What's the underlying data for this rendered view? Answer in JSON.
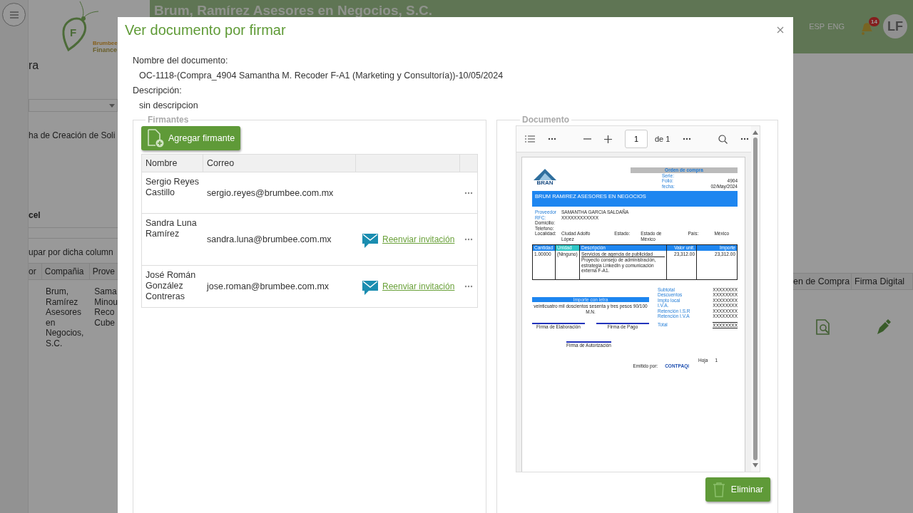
{
  "app_header": {
    "title": "Brum, Ramírez Asesores en Negocios, S.C.",
    "logo": {
      "letter": "F",
      "name_top": "Brumbee",
      "name_bottom": "Finance"
    },
    "languages": [
      "ESP",
      "ENG"
    ],
    "notifications": "14",
    "avatar": "LF"
  },
  "background": {
    "page_title": "ra",
    "filter_label": "ha de Creación de Soli",
    "export_label": "cel",
    "group_hint": "upar por dicha column",
    "left_columns": [
      "or",
      "Compañia",
      "Prove"
    ],
    "company": "Brum, Ramírez Asesores en Negocios, S.C.",
    "provider_lines": [
      "Sama",
      "Minou",
      "Reco",
      "Cube"
    ],
    "right_columns": [
      "en de Compra",
      "Firma Digital"
    ]
  },
  "dialog": {
    "title": "Ver documento por firmar",
    "fields": [
      {
        "label": "Nombre del documento:",
        "value": "OC-1118-(Compra_4904 Samantha M. Recoder F-A1 (Marketing y Consultoría))-10/05/2024"
      },
      {
        "label": "Descripción:",
        "value": "sin descripcion"
      }
    ],
    "signers": {
      "legend": "Firmantes",
      "add_button": "Agregar firmante",
      "columns": [
        "Nombre",
        "Correo"
      ],
      "rows": [
        {
          "name": "Sergio Reyes Castillo",
          "email": "sergio.reyes@brumbee.com.mx"
        },
        {
          "name": "Sandra Luna Ramírez",
          "email": "sandra.luna@brumbee.com.mx",
          "resend_link": "Reenviar invitación"
        },
        {
          "name": "José Román González Contreras",
          "email": "jose.roman@brumbee.com.mx",
          "resend_link": "Reenviar invitación"
        }
      ]
    },
    "document": {
      "legend": "Documento",
      "page_input": "1",
      "page_total": "de 1",
      "page": {
        "logo_text": "BRAN",
        "heading": "Orden de compra",
        "meta": [
          {
            "label": "Serie:"
          },
          {
            "label": "Folio:",
            "value": "4904"
          },
          {
            "label": "fecha:",
            "value": "02/May/2024"
          }
        ],
        "company": "BRUM RAMIREZ ASESORES EN NEGOCIOS",
        "supplier": [
          {
            "label": "Proveedor",
            "value": "SAMANTHA GARCIA SALDAÑA"
          },
          {
            "label": "RFC:",
            "value": "XXXXXXXXXXXX"
          },
          {
            "label": "Domicilio:"
          },
          {
            "label": "Telefono:"
          }
        ],
        "locality": [
          {
            "label": "Localidad:",
            "value": "Ciudad Adolfo López"
          },
          {
            "label": "Estado:",
            "value": "Estado de México"
          },
          {
            "label": "País:",
            "value": "México"
          }
        ],
        "item_columns": [
          "Cantidad",
          "Unidad",
          "Descripción",
          "Valor unit.",
          "Importe"
        ],
        "item": {
          "cells": [
            "1.00000",
            "(Ninguno)",
            "Servicios de agencia de publicidad",
            "23,312.00",
            "23,312.00"
          ],
          "note": "Proyecto consejo de administración, estrategia LinkedIn y comunicación externa F-A1."
        },
        "amount_words_label": "Importe con letra",
        "amount_words": "veinticuatro mil doscientos sesenta y tres pesos 90/100 M.N.",
        "totals": [
          {
            "label": "Subtotal",
            "value": "XXXXXXXX"
          },
          {
            "label": "Descuentos",
            "value": "XXXXXXXX"
          },
          {
            "label": "Impto local",
            "value": "XXXXXXXX"
          },
          {
            "label": "I.V.A.",
            "value": "XXXXXXXX"
          },
          {
            "label": "Retención I.S.R",
            "value": "XXXXXXXX"
          },
          {
            "label": "Retención I.V.A",
            "value": "XXXXXXXX"
          },
          {
            "label": "Total",
            "value": "XXXXXXXX"
          }
        ],
        "signatures": [
          "Firma de Elaboración",
          "Firma de Pago",
          "Firma de Autorización"
        ],
        "sheet_label": "Hoja",
        "sheet_number": "1",
        "issued_by_label": "Emitido por:",
        "issued_by": "CONTPAQi"
      }
    },
    "delete_button": "Eliminar"
  }
}
